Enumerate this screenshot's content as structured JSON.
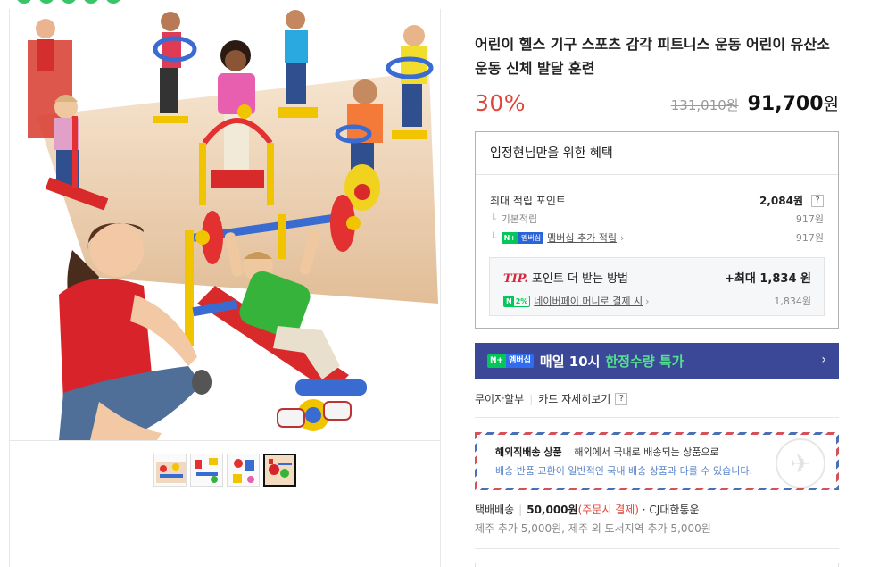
{
  "product": {
    "title": "어린이 헬스 기구 스포츠 감각 피트니스 운동 어린이 유산소 운동 신체 발달 훈련",
    "discount": "30%",
    "original_price": "131,010원",
    "sale_price": "91,700",
    "sale_currency": "원"
  },
  "gallery": {
    "thumbnail_count": 4,
    "active_index": 3
  },
  "benefit": {
    "header": "임정현님만을 위한 혜택",
    "max_points_label": "최대 적립 포인트",
    "max_points_value": "2,084원",
    "help": "?",
    "basic_label": "기본적립",
    "basic_value": "917원",
    "membership_label": "멤버십 추가 적립",
    "membership_value": "917원",
    "badge_n": "N+",
    "badge_membership": "멤버십",
    "tip_label": "TIP.",
    "tip_text": "포인트 더 받는 방법",
    "tip_max": "+최대 1,834 원",
    "npay_rate": "2%",
    "npay_text": "네이버페이 머니로 결제 시",
    "npay_value": "1,834원"
  },
  "banner": {
    "badge_n": "N+",
    "badge_membership": "멤버십",
    "text": "매일 10시",
    "highlight": "한정수량 특가",
    "arrow": "›"
  },
  "card_links": {
    "installment": "무이자할부",
    "card_detail": "카드 자세히보기",
    "help": "?"
  },
  "overseas": {
    "label": "해외직배송 상품",
    "desc": "해외에서 국내로 배송되는 상품으로",
    "note": "배송·반품·교환이 일반적인 국내 배송 상품과 다를 수 있습니다."
  },
  "shipping": {
    "method": "택배배송",
    "fee": "50,000원",
    "fee_note": "(주문시 결제)",
    "carrier": "· CJ대한통운",
    "extra": "제주 추가 5,000원, 제주 외 도서지역 추가 5,000원"
  },
  "colors": {
    "discount_red": "#e0463b",
    "banner_navy": "#3b4897",
    "naver_green": "#03c75a"
  }
}
